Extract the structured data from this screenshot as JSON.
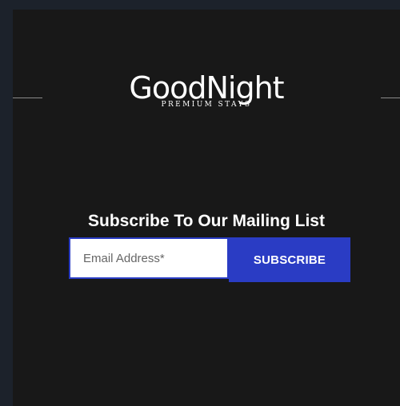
{
  "brand": {
    "name": "GoodNight",
    "tagline": "PREMIUM STAYS"
  },
  "newsletter": {
    "heading": "Subscribe To Our Mailing List",
    "email_placeholder": "Email Address*",
    "email_value": "",
    "button_label": "SUBSCRIBE"
  },
  "colors": {
    "background": "#181818",
    "outer_background": "#1c222b",
    "accent": "#2a3cc4",
    "text": "#ffffff"
  }
}
